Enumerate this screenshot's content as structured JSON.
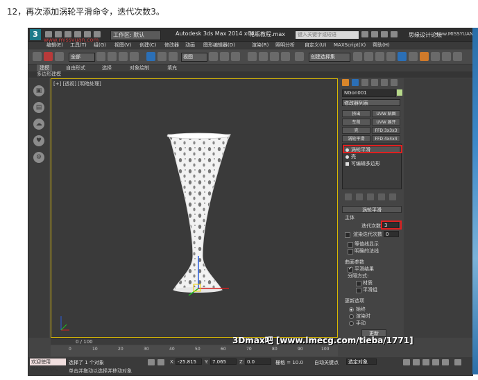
{
  "caption": "12，再次添加涡轮平滑命令，迭代次数3。",
  "titlebar": {
    "workspace": "工作区: 默认",
    "app_title": "Autodesk 3ds Max  2014 x64",
    "file_name": "花瓶教程.max",
    "search_placeholder": "键入关键字或短语",
    "watermark_right": "思缘设计论坛",
    "watermark_url": "www.MISSYUAN.COM"
  },
  "watermark_left": "www.missyuan.com",
  "menus": [
    "编辑(E)",
    "工具(T)",
    "组(G)",
    "视图(V)",
    "创建(C)",
    "修改器",
    "动画",
    "图形编辑器(D)",
    "渲染(R)",
    "照明分析",
    "自定义(U)",
    "MAXScript(X)",
    "帮助(H)"
  ],
  "toolbar": {
    "selection_filter": "全部",
    "reference_coord": "视图",
    "named_selection": "创建选择集"
  },
  "ribbon": {
    "tabs": [
      "建模",
      "自由形式",
      "选择",
      "对象绘制",
      "填充"
    ],
    "active_tab": "建模",
    "subtitle": "多边形建模"
  },
  "viewport": {
    "label": "[+] [透视] [明暗处理]"
  },
  "command_panel": {
    "object_name": "NGon001",
    "modifier_list": "修改器列表",
    "buttons": [
      [
        "挤出",
        "UVW 贴图"
      ],
      [
        "车削",
        "UVW 展开"
      ],
      [
        "壳",
        "FFD 3x3x3"
      ],
      [
        "涡轮平滑",
        "FFD 4x4x4"
      ]
    ],
    "stack": [
      "涡轮平滑",
      "壳",
      "可编辑多边形"
    ],
    "rollout_title": "涡轮平滑",
    "main_group": "主体",
    "iterations_label": "迭代次数",
    "iterations_value": "3",
    "render_iters_label": "渲染迭代次数",
    "render_iters_value": "0",
    "isoline_label": "等值线显示",
    "explicit_normals_label": "明确的法线",
    "surface_group": "曲面参数",
    "smooth_result_label": "平滑结果",
    "separate_label": "分隔方式:",
    "materials_label": "材质",
    "smoothing_groups_label": "平滑组",
    "update_group": "更新选项",
    "update_options": [
      "始终",
      "渲染时",
      "手动"
    ],
    "update_button": "更新"
  },
  "timeline": {
    "frame_counter": "0 / 100",
    "ticks": [
      "0",
      "10",
      "20",
      "30",
      "40",
      "50",
      "60",
      "70",
      "80",
      "90",
      "100"
    ]
  },
  "statusbar": {
    "script_box": "欢迎使用 MAXScript。",
    "selected": "选择了 1 个对象",
    "prompt": "单击并拖动以选择并移动对象",
    "x_value": "-25.815",
    "y_value": "7.065",
    "z_value": "0.0",
    "grid": "栅格 = 10.0",
    "auto_key": "自动关键点",
    "key_filter": "选定对象",
    "watermark": "3Dmax吧 [www.lmecg.com/tieba/1771]"
  },
  "colors": {
    "highlight": "#e02020",
    "viewport_border": "#d8b800",
    "accent_blue": "#2b6fb6"
  }
}
